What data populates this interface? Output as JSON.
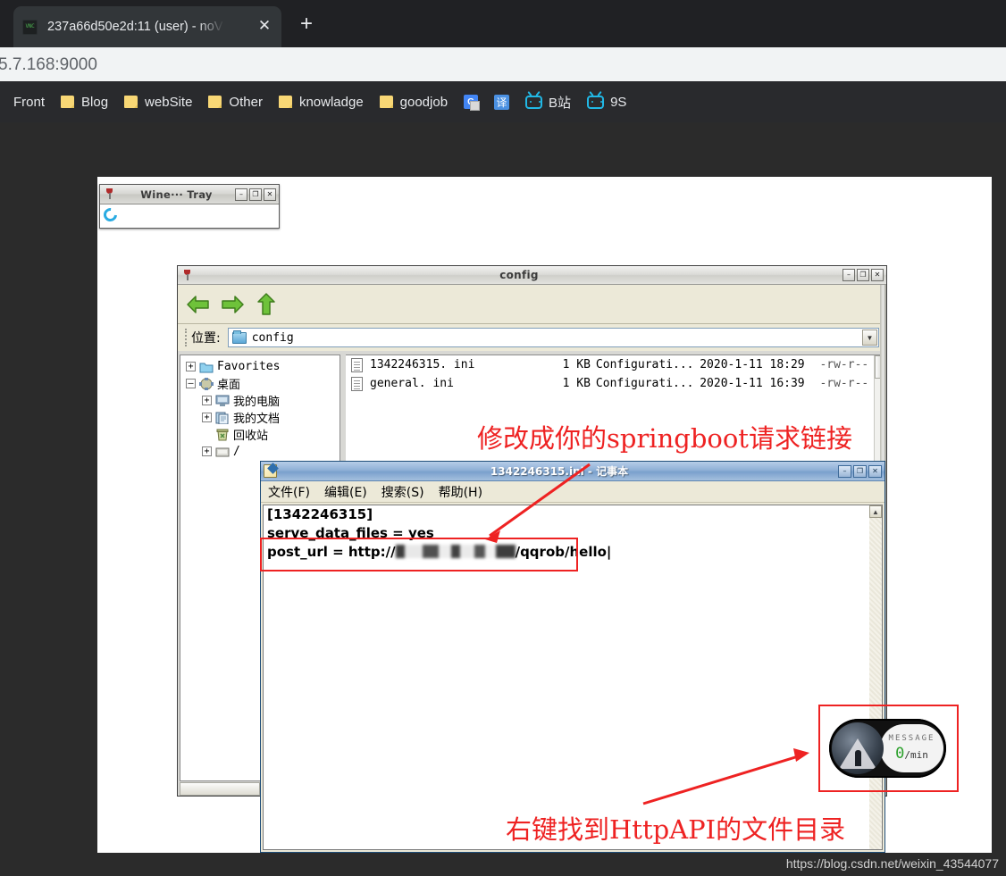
{
  "browser": {
    "tab": {
      "favicon": "vnc-icon",
      "title": "237a66d50e2d:11 (user) - noV",
      "close_label": "✕"
    },
    "newtab_label": "+",
    "omnibox_value": "5.7.168:9000",
    "bookmarks": [
      {
        "label": "Front",
        "icon": "none"
      },
      {
        "label": "Blog",
        "icon": "folder-icon"
      },
      {
        "label": "webSite",
        "icon": "folder-icon"
      },
      {
        "label": "Other",
        "icon": "folder-icon"
      },
      {
        "label": "knowladge",
        "icon": "folder-icon"
      },
      {
        "label": "goodjob",
        "icon": "folder-icon"
      },
      {
        "label": "",
        "icon": "google-translate-icon"
      },
      {
        "label": "",
        "icon": "fanyi-icon",
        "glyph": "译"
      },
      {
        "label": "B站",
        "icon": "bilibili-icon"
      },
      {
        "label": "9S",
        "icon": "bilibili-icon"
      }
    ]
  },
  "wine_tray": {
    "title": "Wine··· Tray",
    "minimize": "–",
    "maximize": "❐",
    "close": "✕"
  },
  "config_window": {
    "title": "config",
    "minimize": "–",
    "maximize": "❐",
    "close": "✕",
    "toolbar": {
      "back": "back-arrow",
      "forward": "forward-arrow",
      "up": "up-arrow"
    },
    "location_label": "位置:",
    "location_value": "config",
    "combo_arrow": "▼",
    "tree": [
      {
        "label": "Favorites",
        "expander": "+",
        "indent": 0,
        "icon": "folder-icon"
      },
      {
        "label": "桌面",
        "expander": "–",
        "indent": 0,
        "icon": "desktop-icon"
      },
      {
        "label": "我的电脑",
        "expander": "+",
        "indent": 1,
        "icon": "computer-icon"
      },
      {
        "label": "我的文档",
        "expander": "+",
        "indent": 1,
        "icon": "documents-icon"
      },
      {
        "label": "回收站",
        "expander": "",
        "indent": 1,
        "icon": "recyclebin-icon"
      },
      {
        "label": "/",
        "expander": "+",
        "indent": 1,
        "icon": "drive-icon"
      }
    ],
    "files": [
      {
        "name": "1342246315. ini",
        "size": "1 KB",
        "type": "Configurati...",
        "date": "2020-1-11 18:29",
        "perm": "-rw-r--"
      },
      {
        "name": "general. ini",
        "size": "1 KB",
        "type": "Configurati...",
        "date": "2020-1-11 16:39",
        "perm": "-rw-r--"
      }
    ]
  },
  "notepad": {
    "title": "1342246315.ini - 记事本",
    "minimize": "–",
    "maximize": "❐",
    "close": "✕",
    "menu": [
      "文件(F)",
      "编辑(E)",
      "搜索(S)",
      "帮助(H)"
    ],
    "lines": [
      "[1342246315]",
      "serve_data_files = yes"
    ],
    "url_line_prefix": "post_url = http://",
    "url_line_suffix": "/qqrob/hello",
    "scroll_up": "▲"
  },
  "annotations": {
    "top": "修改成你的springboot请求链接",
    "bottom": "右键找到HttpAPI的文件目录",
    "highlight_color": "#ee2222"
  },
  "message_widget": {
    "label": "MESSAGE",
    "value": "0",
    "unit": "/min",
    "value_color": "#2aa02a"
  },
  "watermark": "https://blog.csdn.net/weixin_43544077"
}
